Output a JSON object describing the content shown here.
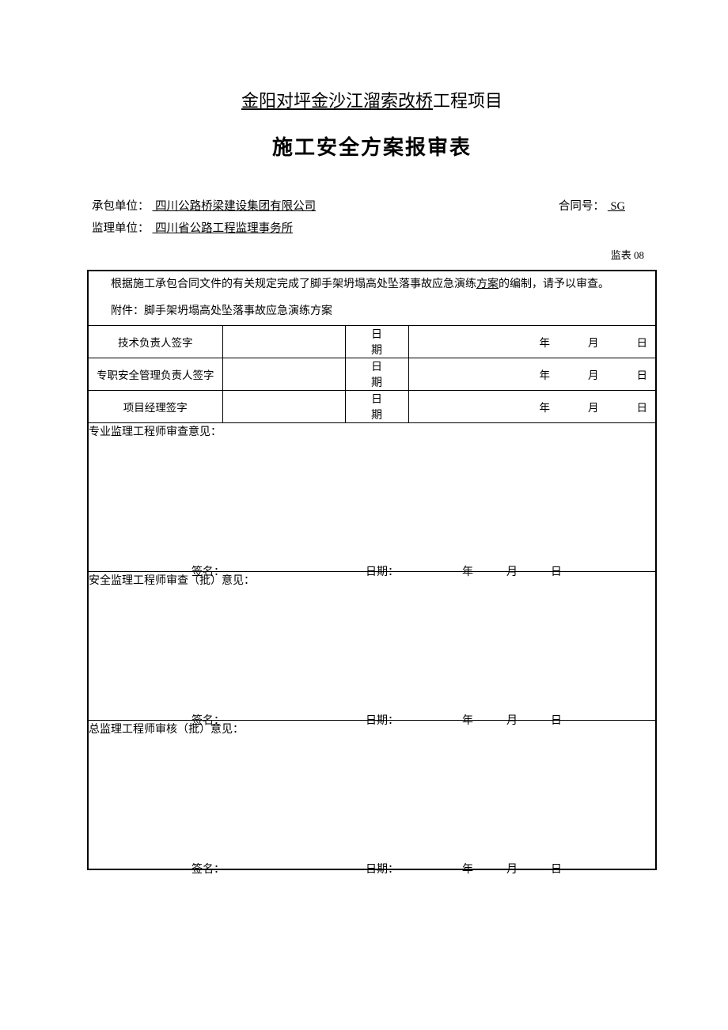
{
  "title": {
    "project_underlined": "金阳对坪金沙江溜索改桥",
    "project_suffix": "工程项目",
    "form_name": "施工安全方案报审表"
  },
  "meta": {
    "contractor_label": "承包单位：",
    "contractor_value": "  四川公路桥梁建设集团有限公司  ",
    "contract_no_label": "合同号：",
    "contract_no_value": "  SG  ",
    "supervisor_label": "监理单位：",
    "supervisor_value": "  四川省公路工程监理事务所  ",
    "form_code": "监表 08"
  },
  "intro": {
    "prefix": "根据施工承包合同文件的有关规定完成了脚手架坍塌高处坠落事故应急演练",
    "underlined": "方案",
    "suffix": "的编制，请予以审查。",
    "attachment_label": "附件：",
    "attachment_value": "脚手架坍塌高处坠落事故应急演练方案"
  },
  "sign_rows": [
    {
      "label": "技术负责人签字",
      "date_label": "日 期"
    },
    {
      "label": "专职安全管理负责人签字",
      "date_label": "日 期"
    },
    {
      "label": "项目经理签字",
      "date_label": "日 期"
    }
  ],
  "date_units": {
    "year": "年",
    "month": "月",
    "day": "日"
  },
  "review_sections": [
    {
      "header": "专业监理工程师审查意见："
    },
    {
      "header": "安全监理工程师审查（批）意见："
    },
    {
      "header": "总监理工程师审核（批）意见："
    }
  ],
  "review_sig": {
    "sign_label": "签名：",
    "date_label": "日期："
  }
}
